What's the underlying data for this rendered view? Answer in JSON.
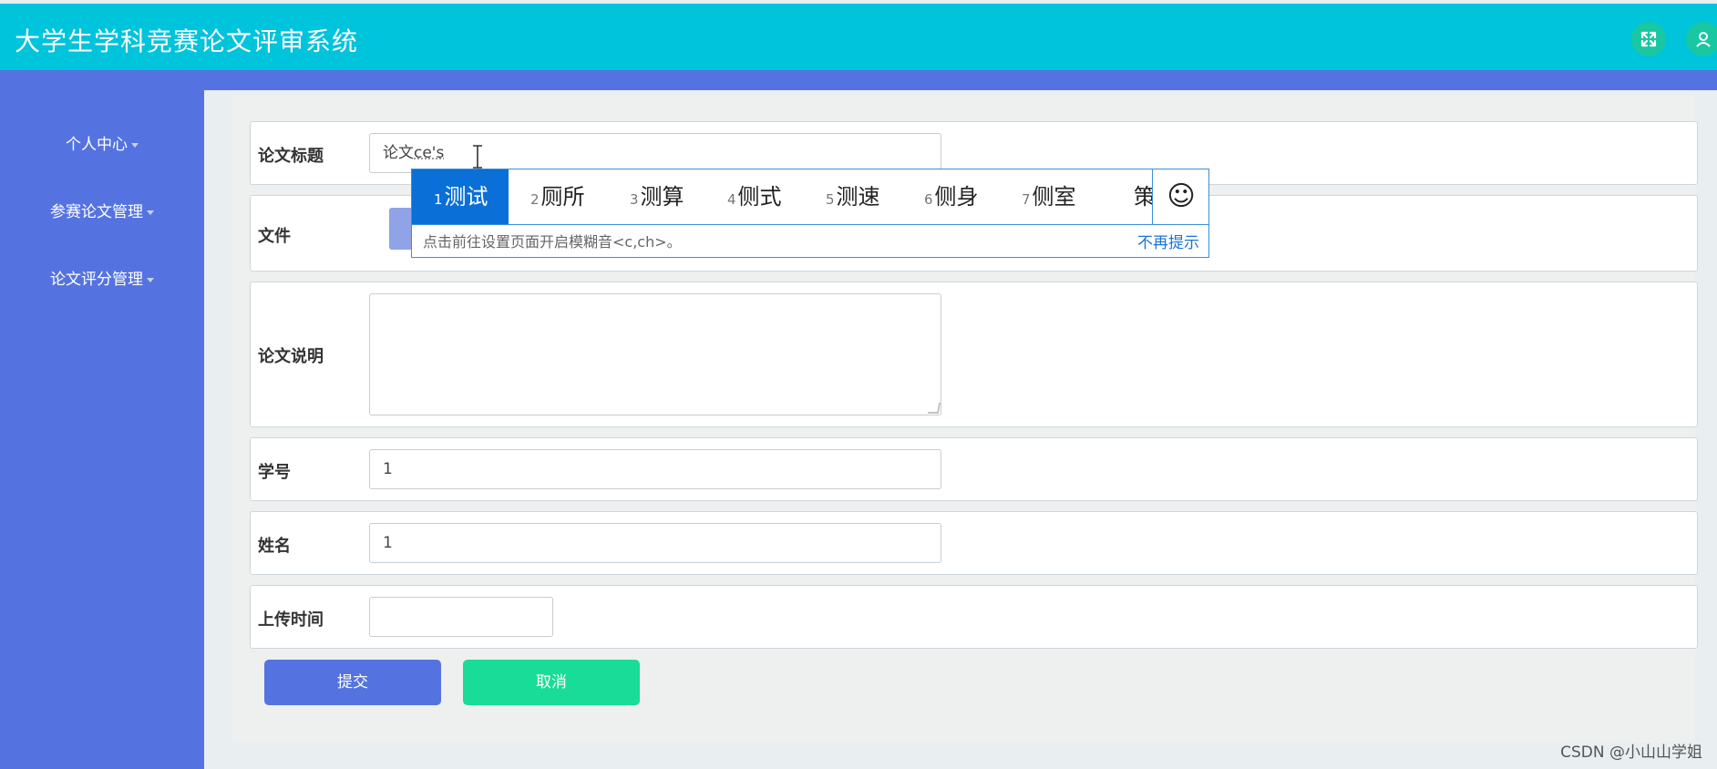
{
  "app": {
    "title": "大学生学科竞赛论文评审系统"
  },
  "header": {
    "fullscreen_icon": "expand-arrows-icon",
    "user_icon": "user-avatar-icon"
  },
  "sidebar": {
    "items": [
      {
        "label": "个人中心"
      },
      {
        "label": "参赛论文管理"
      },
      {
        "label": "论文评分管理"
      }
    ]
  },
  "form": {
    "title_field": {
      "label": "论文标题",
      "value_prefix": "论文",
      "composing": "ce's"
    },
    "file_field": {
      "label": "文件"
    },
    "desc_field": {
      "label": "论文说明",
      "value": ""
    },
    "student_id_field": {
      "label": "学号",
      "value": "1"
    },
    "name_field": {
      "label": "姓名",
      "value": "1"
    },
    "upload_time_field": {
      "label": "上传时间",
      "value": ""
    },
    "submit_label": "提交",
    "cancel_label": "取消"
  },
  "ime": {
    "candidates": [
      {
        "num": "1",
        "text": "测试"
      },
      {
        "num": "2",
        "text": "厕所"
      },
      {
        "num": "3",
        "text": "测算"
      },
      {
        "num": "4",
        "text": "侧式"
      },
      {
        "num": "5",
        "text": "测速"
      },
      {
        "num": "6",
        "text": "侧身"
      },
      {
        "num": "7",
        "text": "侧室"
      },
      {
        "num": "",
        "text": "策"
      }
    ],
    "emoji_icon": "smiley-icon",
    "hint": "点击前往设置页面开启模糊音<c,ch>。",
    "dismiss": "不再提示"
  },
  "watermark": "CSDN @小山山学姐",
  "colors": {
    "topbar": "#00c3dc",
    "sidebar": "#5573e0",
    "submit": "#5573e0",
    "cancel": "#19dc98",
    "ime_selected": "#0a6fd6"
  }
}
